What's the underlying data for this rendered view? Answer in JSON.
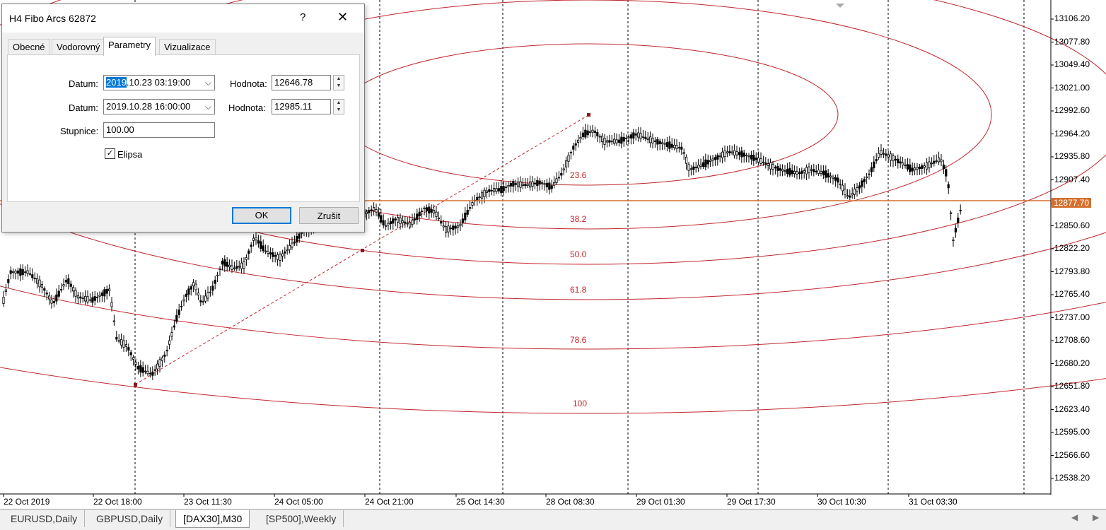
{
  "dialog": {
    "title": "H4 Fibo Arcs 62872",
    "help": "?",
    "close": "✕",
    "tabs": [
      "Obecné",
      "Vodorovný",
      "Parametry",
      "Vizualizace"
    ],
    "active_tab": "Parametry",
    "date1_label": "Datum:",
    "date1_sel": "2019",
    "date1_rest": ".10.23 03:19:00",
    "value1_label": "Hodnota:",
    "value1": "12646.78",
    "date2_label": "Datum:",
    "date2": "2019.10.28 16:00:00",
    "value2_label": "Hodnota:",
    "value2": "12985.11",
    "scale_label": "Stupnice:",
    "scale": "100.00",
    "ellipse_label": "Elipsa",
    "ellipse_checked": true,
    "ok": "OK",
    "cancel": "Zrušit"
  },
  "price_axis": [
    "13106.20",
    "13077.80",
    "13049.40",
    "13021.00",
    "12992.60",
    "12964.20",
    "12935.80",
    "12907.40",
    "12877.70",
    "12850.60",
    "12822.20",
    "12793.80",
    "12765.40",
    "12737.00",
    "12708.60",
    "12680.20",
    "12651.80",
    "12623.40",
    "12595.00",
    "12566.60",
    "12538.20"
  ],
  "current_price": "12877.70",
  "time_axis": [
    "22 Oct 2019",
    "22 Oct 18:00",
    "23 Oct 11:30",
    "24 Oct 05:00",
    "24 Oct 21:00",
    "25 Oct 14:30",
    "28 Oct 08:30",
    "29 Oct 01:30",
    "29 Oct 17:30",
    "30 Oct 10:30",
    "31 Oct 03:30"
  ],
  "fib_levels": [
    "23.6",
    "38.2",
    "50.0",
    "61.8",
    "78.6",
    "100"
  ],
  "symbol_tabs": [
    "EURUSD,Daily",
    "GBPUSD,Daily",
    "[DAX30],M30",
    "[SP500],Weekly"
  ],
  "active_symbol": "[DAX30],M30",
  "colors": {
    "arc": "#c0262d",
    "current_price": "#d46f2f",
    "accent": "#0078d7"
  },
  "chart_data": {
    "type": "candlestick",
    "instrument": "[DAX30]",
    "timeframe": "M30",
    "ylim": [
      12510,
      13120
    ],
    "anchor_points": [
      {
        "date": "2019.10.23 03:19:00",
        "value": 12646.78
      },
      {
        "date": "2019.10.28 16:00:00",
        "value": 12985.11
      }
    ],
    "fibonacci_levels": [
      23.6,
      38.2,
      50.0,
      61.8,
      78.6,
      100
    ],
    "current_price": 12877.7
  }
}
